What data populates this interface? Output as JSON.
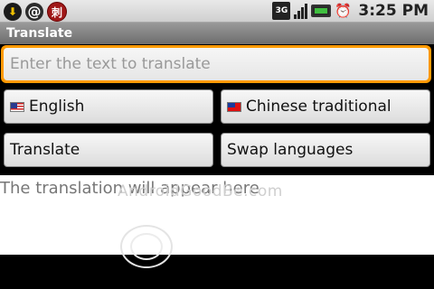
{
  "status_bar": {
    "time": "3:25 PM",
    "network_label": "3G",
    "left_icons": [
      "download-icon",
      "at-icon",
      "app-icon"
    ],
    "right_icons": [
      "3g-icon",
      "signal-icon",
      "battery-icon",
      "alarm-icon"
    ]
  },
  "app": {
    "title": "Translate"
  },
  "input": {
    "placeholder": "Enter the text to translate",
    "value": ""
  },
  "source_language": {
    "label": "English",
    "flag": "us-flag-icon"
  },
  "target_language": {
    "label": "Chinese traditional",
    "flag": "taiwan-flag-icon"
  },
  "buttons": {
    "translate": "Translate",
    "swap": "Swap languages"
  },
  "output": {
    "text": "The translation will appear here"
  },
  "watermark": {
    "text": "AndroidGoodBe.com"
  },
  "colors": {
    "focus_border": "#ff9a00",
    "title_bar": "#7a7a7a",
    "background": "#000000"
  }
}
